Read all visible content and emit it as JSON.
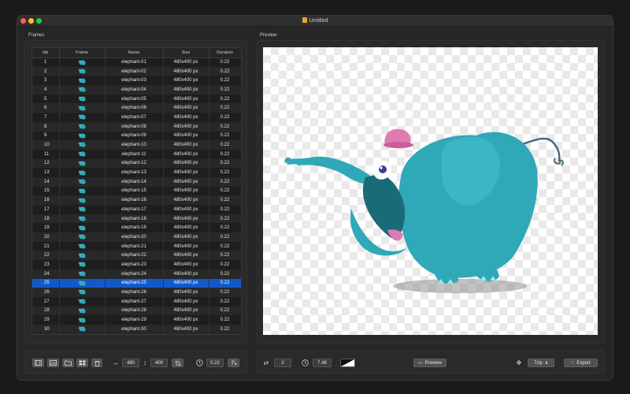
{
  "window": {
    "title": "Untitled"
  },
  "frames_label": "Frames",
  "preview_label": "Preview",
  "table": {
    "columns": [
      "Idx",
      "Frame",
      "Name",
      "Size",
      "Duration"
    ],
    "selected_index": 25,
    "rows": [
      {
        "idx": "1",
        "name": "elephant-01",
        "size": "480x400 px",
        "duration": "0.22"
      },
      {
        "idx": "2",
        "name": "elephant-02",
        "size": "480x400 px",
        "duration": "0.22"
      },
      {
        "idx": "3",
        "name": "elephant-03",
        "size": "480x400 px",
        "duration": "0.22"
      },
      {
        "idx": "4",
        "name": "elephant-04",
        "size": "480x400 px",
        "duration": "0.22"
      },
      {
        "idx": "5",
        "name": "elephant-05",
        "size": "480x400 px",
        "duration": "0.22"
      },
      {
        "idx": "6",
        "name": "elephant-06",
        "size": "480x400 px",
        "duration": "0.22"
      },
      {
        "idx": "7",
        "name": "elephant-07",
        "size": "480x400 px",
        "duration": "0.22"
      },
      {
        "idx": "8",
        "name": "elephant-08",
        "size": "480x400 px",
        "duration": "0.22"
      },
      {
        "idx": "9",
        "name": "elephant-09",
        "size": "480x400 px",
        "duration": "0.22"
      },
      {
        "idx": "10",
        "name": "elephant-10",
        "size": "480x400 px",
        "duration": "0.22"
      },
      {
        "idx": "11",
        "name": "elephant-11",
        "size": "480x400 px",
        "duration": "0.22"
      },
      {
        "idx": "12",
        "name": "elephant-12",
        "size": "480x400 px",
        "duration": "0.22"
      },
      {
        "idx": "13",
        "name": "elephant-13",
        "size": "480x400 px",
        "duration": "0.22"
      },
      {
        "idx": "14",
        "name": "elephant-14",
        "size": "480x400 px",
        "duration": "0.22"
      },
      {
        "idx": "15",
        "name": "elephant-15",
        "size": "480x400 px",
        "duration": "0.22"
      },
      {
        "idx": "16",
        "name": "elephant-16",
        "size": "480x400 px",
        "duration": "0.22"
      },
      {
        "idx": "17",
        "name": "elephant-17",
        "size": "480x400 px",
        "duration": "0.22"
      },
      {
        "idx": "18",
        "name": "elephant-18",
        "size": "480x400 px",
        "duration": "0.22"
      },
      {
        "idx": "19",
        "name": "elephant-19",
        "size": "480x400 px",
        "duration": "0.22"
      },
      {
        "idx": "20",
        "name": "elephant-20",
        "size": "480x400 px",
        "duration": "0.22"
      },
      {
        "idx": "21",
        "name": "elephant-21",
        "size": "480x400 px",
        "duration": "0.22"
      },
      {
        "idx": "22",
        "name": "elephant-22",
        "size": "480x400 px",
        "duration": "0.22"
      },
      {
        "idx": "23",
        "name": "elephant-23",
        "size": "480x400 px",
        "duration": "0.22"
      },
      {
        "idx": "24",
        "name": "elephant-24",
        "size": "480x400 px",
        "duration": "0.22"
      },
      {
        "idx": "25",
        "name": "elephant-25",
        "size": "480x400 px",
        "duration": "0.22"
      },
      {
        "idx": "26",
        "name": "elephant-26",
        "size": "480x400 px",
        "duration": "0.22"
      },
      {
        "idx": "27",
        "name": "elephant-27",
        "size": "480x400 px",
        "duration": "0.22"
      },
      {
        "idx": "28",
        "name": "elephant-28",
        "size": "480x400 px",
        "duration": "0.22"
      },
      {
        "idx": "29",
        "name": "elephant-29",
        "size": "480x400 px",
        "duration": "0.22"
      },
      {
        "idx": "30",
        "name": "elephant-30",
        "size": "480x400 px",
        "duration": "0.22"
      }
    ]
  },
  "toolbar_left": {
    "width_value": "480",
    "height_value": "400",
    "duration_value": "0.22"
  },
  "toolbar_right": {
    "loop_value": "2",
    "total_time_value": "7.48",
    "preview_label": "Preview",
    "format_value": "7zip",
    "export_label": "Export"
  },
  "colors": {
    "selection": "#1459c9",
    "elephant_body": "#2fa8b7",
    "hat": "#e07ab2"
  },
  "icons": {
    "frame_thumb": "elephant-thumb-icon",
    "add_frames": "filmstrip-icon",
    "add_image": "image-icon",
    "add_folder": "folder-icon",
    "grid": "grid-icon",
    "delete": "trash-icon",
    "resize": "resize-arrows-icon",
    "crop": "crop-icon",
    "timer": "clock-icon",
    "apply_duration": "apply-icon",
    "loop": "loop-icon",
    "time": "stopwatch-icon",
    "background": "background-toggle-icon",
    "preview": "play-preview-icon",
    "move": "move-icon",
    "export": "export-arrow-icon"
  }
}
